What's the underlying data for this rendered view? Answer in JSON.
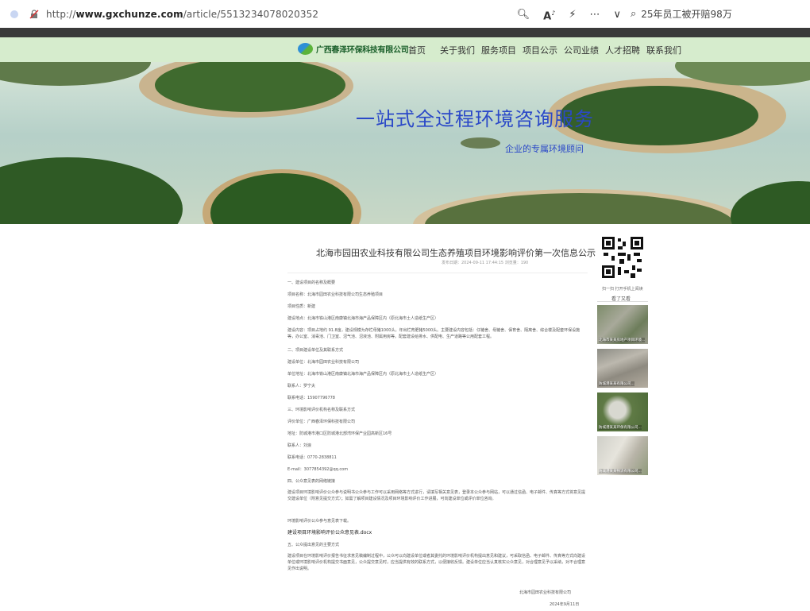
{
  "browser": {
    "url_prefix": "http://",
    "url_host": "www.gxchunze.com",
    "url_path": "/article/5513234078020352",
    "search_text": "25年员工被开赔98万"
  },
  "nav": {
    "logo_text": "广西春泽环保科技有限公司",
    "items": [
      "首页",
      "关于我们",
      "服务项目",
      "项目公示",
      "公司业绩",
      "人才招聘",
      "联系我们"
    ]
  },
  "banner": {
    "title": "一站式全过程环境咨询服务",
    "subtitle": "企业的专属环境顾问"
  },
  "article": {
    "title": "北海市园田农业科技有限公司生态养殖项目环境影响评价第一次信息公示",
    "meta": "发布日期：2024-09-11 17:44:15   浏览量：190",
    "paragraphs": [
      "一、建设项目的名称及概要",
      "项目名称：北海市园田农业科技有限公司生态养殖项目",
      "项目性质：新建",
      "建设地点：北海市铁山港区南康镇北海市海产品保障区内（原北海市土人造纸生产区）",
      "建设内容：项目占地约 91.8亩，建设规模为存栏母猪1000头，年出栏育肥猪5000头。主要建设内容包括：仔猪舍、母猪舍、保育舍、隔离舍、综合楼及配套环保设施等，办公室、消毒池、门卫室、沼气池、沼液池、附属用房等。配套建设给排水、供配电、生产道路等公用配套工程。",
      "二、项目建设单位及其联系方式",
      "建设单位：北海市园田农业科技有限公司",
      "单位地址：北海市铁山港区南康镇北海市海产品保障区内（原北海市土人造纸生产区）",
      "联系人：罗宁夫",
      "联系电话：15907796778",
      "三、环境影响评价机构名称及联系方式",
      "评价单位：广西春泽环保科技有限公司",
      "地址：防城港市港口区防城港北部湾环保产业园高新区16号",
      "联系人：刘浪",
      "联系电话：0770-2838811",
      "E-mail：3077854392@qq.com",
      "四、公众意见表的网络链接",
      "建设项目环境影响评价公众参与说明书公众参与工作可以采用网络等方式进行，请填写相关意见表，登录本公众参与网站，可以通过信函、电子邮件、传真等方式将意见提交建设单位（附意见提交方式）；如需了解项目建设情况及项目环境影响评价工作进展，可向建设单位或评价单位咨询。",
      "环境影响评价公众参与意见表下载。",
      "建设项目环境影响评价公众意见表.docx",
      "五、公众提出意见的主要方式",
      "建设项目在环境影响评价报告书征求意见稿编制过程中，公众可以向建设单位或者其委托的环境影响评价机构提出意见和建议，可采取信函、电子邮件、传真等方式向建设单位或环境影响评价机构提交书面意见，公众提交意见时，应当提供有效的联系方式，以便接收反馈。建设单位应当认真核实公众意见，对合理意见予以采纳，对不合理意见作出说明。"
    ],
    "signature_company": "北海市园田农业科技有限公司",
    "signature_date": "2024年9月11日"
  },
  "sidebar": {
    "qr_caption": "扫一扫 打开手机上阅读",
    "seen_label": "看了又看",
    "thumbs": [
      {
        "caption": "北海市某某房地产项目环境..."
      },
      {
        "caption": "防城港某某有限公司..."
      },
      {
        "caption": "防城港某某环保有限公司..."
      },
      {
        "caption": "防城港某某物流有限公司..."
      }
    ]
  }
}
